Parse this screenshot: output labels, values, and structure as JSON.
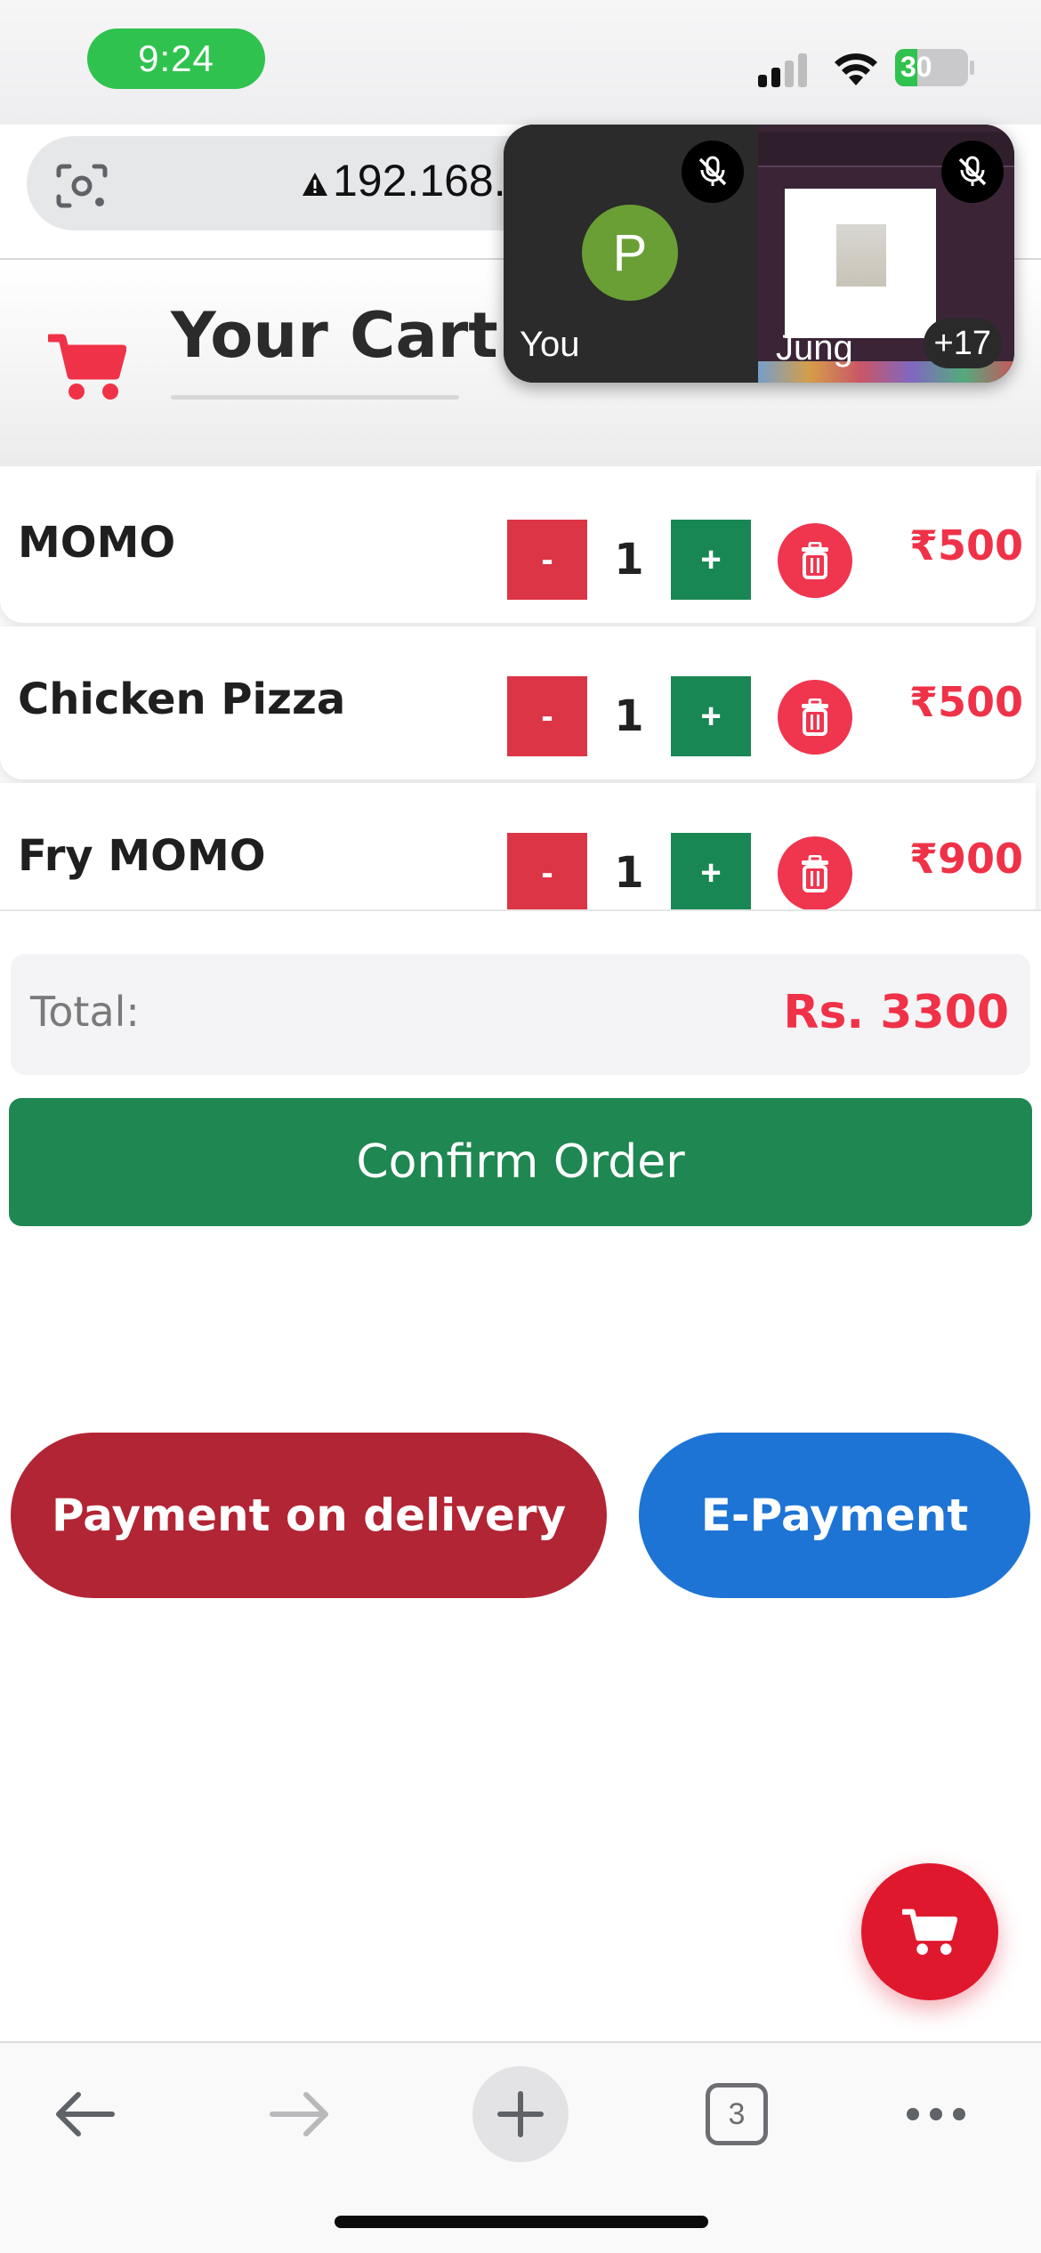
{
  "status_bar": {
    "time": "9:24",
    "battery": "30",
    "battery_level": 0.3
  },
  "browser": {
    "url": "192.168."
  },
  "call_overlay": {
    "self_initial": "P",
    "self_label": "You",
    "presenter_label": "Jung",
    "more_count": "+17"
  },
  "cart": {
    "title": "Your Cart",
    "items": [
      {
        "name": "MOMO",
        "qty": "1",
        "price": "₹500"
      },
      {
        "name": "Chicken Pizza",
        "qty": "1",
        "price": "₹500"
      },
      {
        "name": "Fry MOMO",
        "qty": "1",
        "price": "₹900"
      }
    ],
    "minus_label": "-",
    "plus_label": "+"
  },
  "summary": {
    "total_label": "Total:",
    "total_value": "Rs. 3300",
    "confirm_label": "Confirm Order"
  },
  "payment": {
    "cod_label": "Payment on delivery",
    "online_label": "E-Payment"
  },
  "toolbar": {
    "tab_count": "3"
  },
  "colors": {
    "accent_red": "#ef3248",
    "minus_red": "#dc3545",
    "plus_green": "#198754",
    "confirm_green": "#1f8752",
    "cod_red": "#b22534",
    "epay_blue": "#1d74d4"
  },
  "icons": [
    "camera-lens-icon",
    "warning-icon",
    "mic-off-icon",
    "cart-icon",
    "trash-icon",
    "back-arrow-icon",
    "forward-arrow-icon",
    "plus-icon",
    "tabs-icon",
    "more-icon"
  ]
}
